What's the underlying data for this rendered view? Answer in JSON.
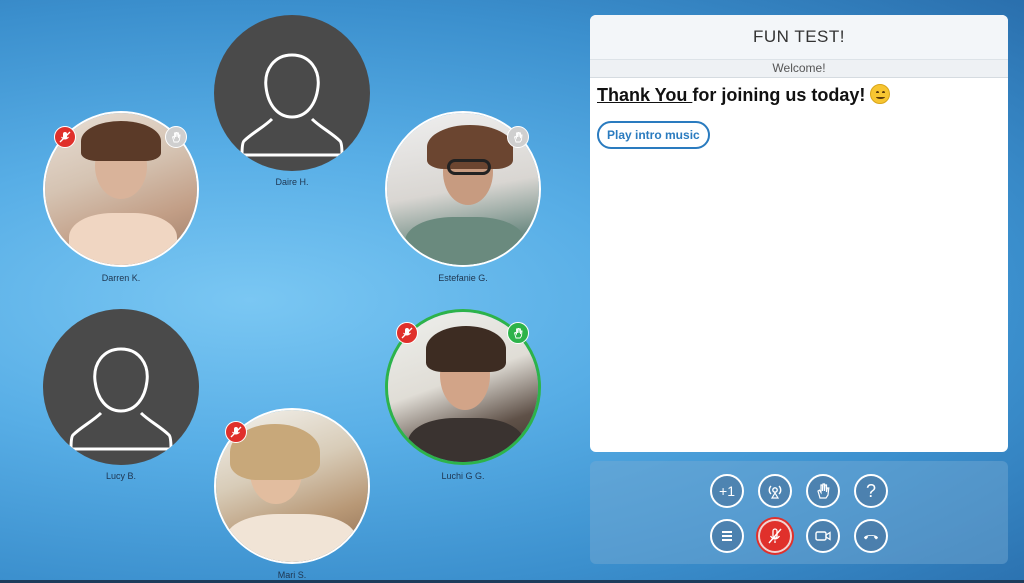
{
  "participants": [
    {
      "name": "Daire H."
    },
    {
      "name": "Darren K."
    },
    {
      "name": "Estefanie G."
    },
    {
      "name": "Lucy B."
    },
    {
      "name": "Luchi G G."
    },
    {
      "name": "Mari S."
    }
  ],
  "panel": {
    "title": "FUN TEST!",
    "subtitle": "Welcome!",
    "message_underlined": "Thank You ",
    "message_rest": "for joining us today!",
    "play_button": "Play intro music"
  },
  "controls": {
    "plus_one": "+1",
    "help": "?"
  },
  "colors": {
    "mute_red": "#e0302b",
    "speaking_green": "#2db34a",
    "link_blue": "#2a7bbf"
  }
}
